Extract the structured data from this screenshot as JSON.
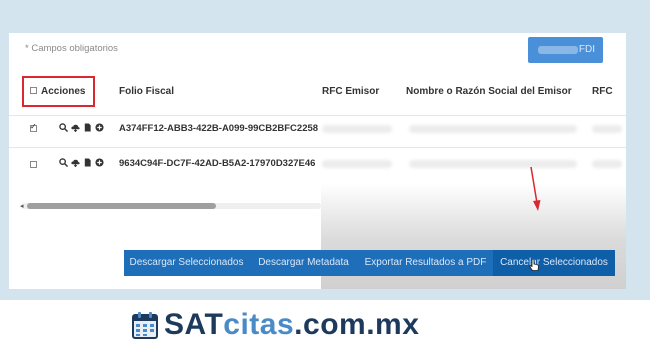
{
  "form": {
    "required_note": "* Campos obligatorios",
    "top_button_label": "FDI"
  },
  "table": {
    "headers": [
      "Acciones",
      "Folio Fiscal",
      "RFC Emisor",
      "Nombre o Razón Social del Emisor",
      "RFC"
    ],
    "rows": [
      {
        "checked": true,
        "folio": "A374FF12-ABB3-422B-A099-99CB2BFC2258"
      },
      {
        "checked": false,
        "folio": "9634C94F-DC7F-42AD-B5A2-17970D327E46"
      }
    ]
  },
  "actions": {
    "buttons": [
      "Descargar Seleccionados",
      "Descargar Metadata",
      "Exportar Resultados a PDF",
      "Cancelar Seleccionados"
    ],
    "active": "Cancelar Seleccionados"
  },
  "logo": {
    "part1": "SAT",
    "part2": "citas",
    "part3": ".com.mx"
  },
  "colors": {
    "highlight": "#d9282f",
    "action_bar": "#1f6eb9",
    "logo_dark": "#1d3a5c",
    "logo_light": "#4a8ac7"
  },
  "icons": [
    "search-icon",
    "cloud-download-icon",
    "document-icon",
    "add-circle-icon",
    "calendar-icon"
  ]
}
